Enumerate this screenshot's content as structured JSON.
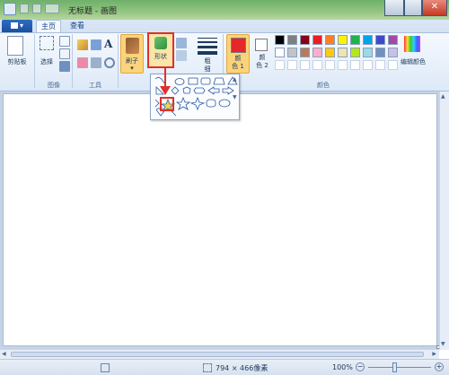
{
  "window": {
    "title": "无标题 - 画图"
  },
  "tabs": {
    "file_label": "▾",
    "home": "主页",
    "view": "查看"
  },
  "ribbon": {
    "clipboard": {
      "label": "剪贴板"
    },
    "image": {
      "select_label": "选择",
      "group_label": "图像"
    },
    "tools": {
      "group_label": "工具",
      "text_icon": "A"
    },
    "brushes": {
      "label": "刷子"
    },
    "shapes": {
      "label": "形状"
    },
    "size": {
      "label": "粗\n细"
    },
    "color1": {
      "label": "颜\n色 1",
      "color": "#e5262a"
    },
    "color2": {
      "label": "颜\n色 2",
      "color": "#ffffff"
    },
    "colors": {
      "group_label": "颜色",
      "edit_label": "编辑颜色"
    }
  },
  "palette": [
    "#000000",
    "#7f7f7f",
    "#880015",
    "#ed1c24",
    "#ff7f27",
    "#fff200",
    "#22b14c",
    "#00a2e8",
    "#3f48cc",
    "#a349a4",
    "#ffffff",
    "#c3c3c3",
    "#b97a57",
    "#ffaec9",
    "#ffc90e",
    "#efe4b0",
    "#b5e61d",
    "#99d9ea",
    "#7092be",
    "#c8bfe7"
  ],
  "status": {
    "selection_size": "794 × 466像素",
    "zoom": "100%"
  },
  "accent": {
    "highlight": "#e0302a",
    "brushes_bg": "#fbd37a"
  }
}
